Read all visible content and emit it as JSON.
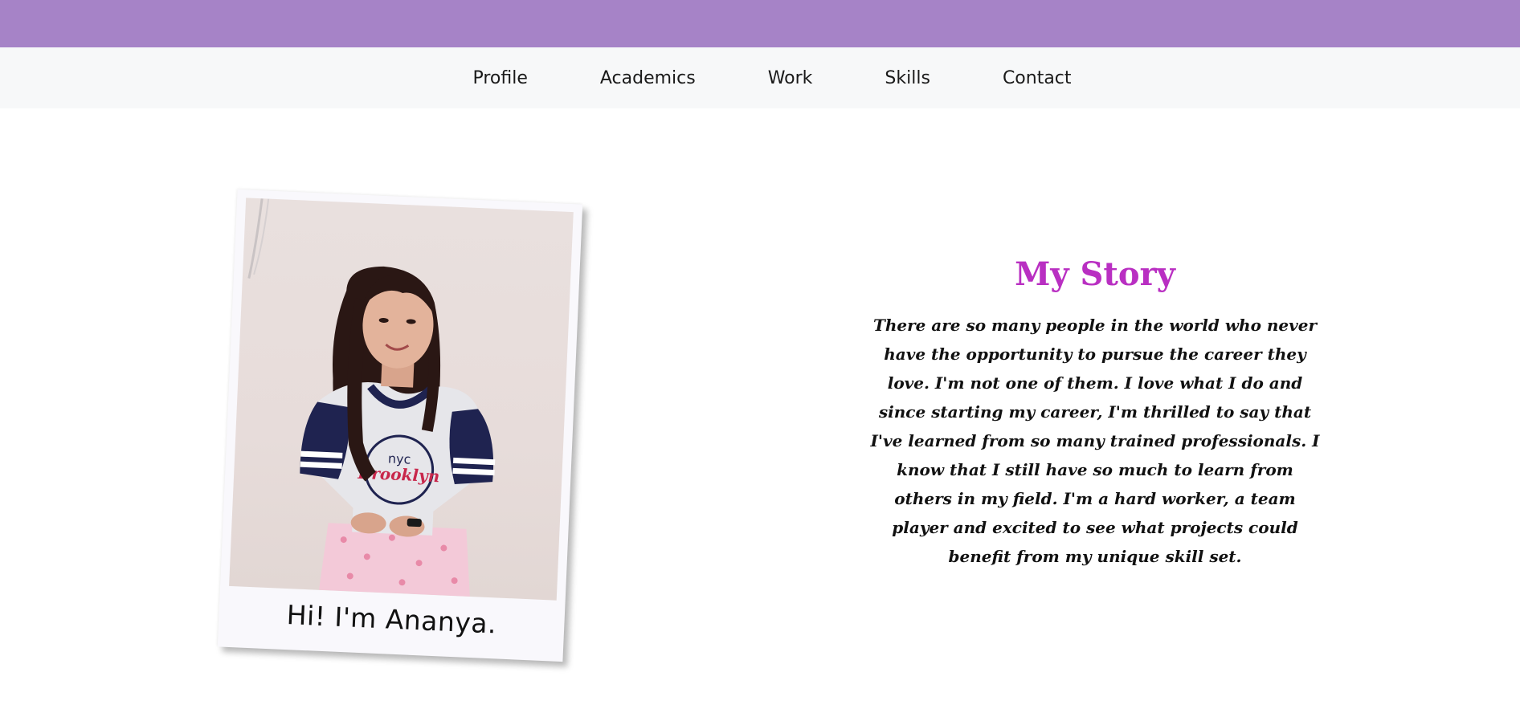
{
  "nav": {
    "items": [
      {
        "label": "Profile"
      },
      {
        "label": "Academics"
      },
      {
        "label": "Work"
      },
      {
        "label": "Skills"
      },
      {
        "label": "Contact"
      }
    ]
  },
  "profile": {
    "caption": "Hi! I'm Ananya.",
    "shirt_text": "nyc brooklyn"
  },
  "story": {
    "title": "My Story",
    "text": "There are so many people in the world who never have the opportunity to pursue the career they love. I'm not one of them. I love what I do and since starting my career, I'm thrilled to say that I've learned from so many trained professionals. I know that I still have so much to learn from others in my field. I'm a hard worker, a team player and excited to see what projects could benefit from my unique skill set."
  },
  "colors": {
    "top_band": "#a683c7",
    "nav_bg": "#f7f8f9",
    "title": "#b92fc2"
  }
}
